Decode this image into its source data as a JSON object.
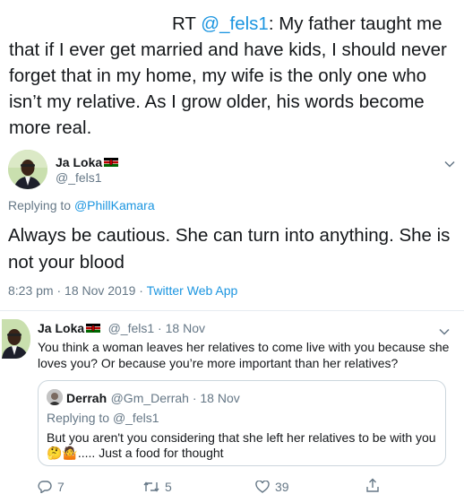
{
  "retweet": {
    "prefix": "RT ",
    "mention": "@_fels1",
    "line1_rest": ": My father taught me",
    "body": "that if I ever get married and have kids, I should never forget that in my home, my wife is the only one who isn’t my relative. As I grow older, his words become more real."
  },
  "main_tweet": {
    "author_name": "Ja Loka",
    "author_handle": "@_fels1",
    "replying_prefix": "Replying to ",
    "replying_to": "@PhillKamara",
    "text": "Always be cautious. She can turn into anything. She is not your blood",
    "timestamp": "8:23 pm · 18 Nov 2019 · ",
    "source": "Twitter Web App"
  },
  "reply_tweet": {
    "author_name": "Ja Loka",
    "author_handle": "@_fels1",
    "separator": " · ",
    "date": "18 Nov",
    "text": "You think a woman leaves her relatives to come live with you because she loves you? Or because you’re more important than her relatives?",
    "actions": {
      "reply_count": "7",
      "retweet_count": "5",
      "like_count": "39"
    }
  },
  "quoted_tweet": {
    "author_name": "Derrah",
    "author_handle": "@Gm_Derrah",
    "separator": " · ",
    "date": "18 Nov",
    "replying_prefix": "Replying to ",
    "replying_to": "@_fels1",
    "text_line1": "But you aren't you considering that she left her relatives to be with you",
    "emoji": "🤔🤷",
    "text_line2": "..... Just a food for thought"
  },
  "icons": [
    "kenya-flag-icon",
    "chevron-down-icon",
    "reply-icon",
    "retweet-icon",
    "like-icon",
    "share-icon"
  ],
  "colors": {
    "link": "#1b95e0",
    "secondary": "#657786",
    "divider": "#e6ecf0"
  }
}
